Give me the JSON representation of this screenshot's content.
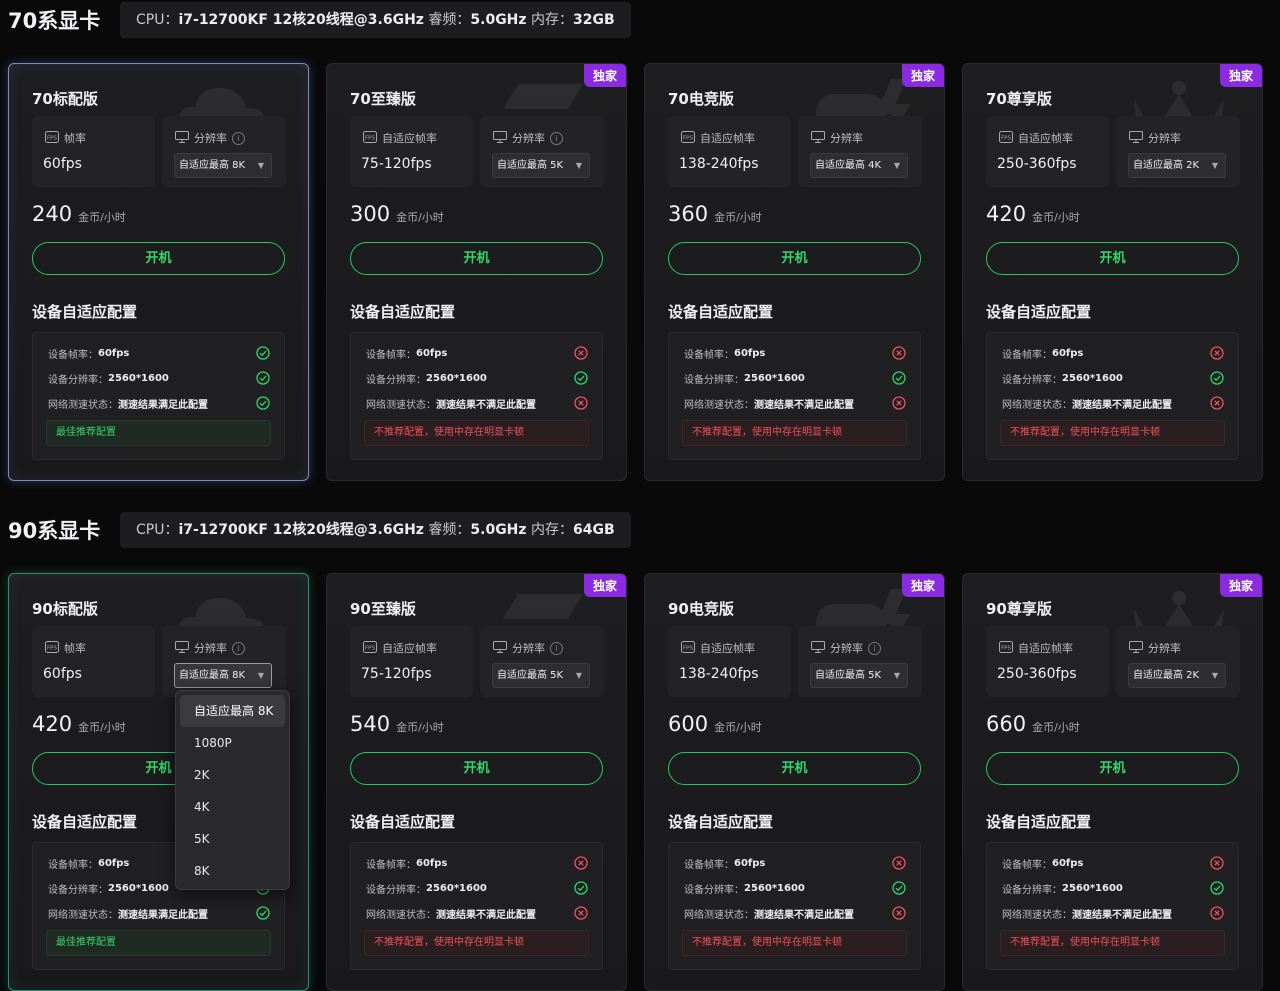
{
  "sections": [
    {
      "title": "70系显卡",
      "cpu": {
        "l1": "CPU：",
        "v1": "i7-12700KF 12核20线程@3.6GHz",
        "l2": " 睿频：",
        "v2": "5.0GHz",
        "l3": " 内存：",
        "v3": "32GB"
      },
      "cards": [
        {
          "name": "70标配版",
          "exclusive": "",
          "fps_label": "帧率",
          "fps": "60fps",
          "res_label": "分辨率",
          "res_value": "自适应最高 8K",
          "price": "240",
          "unit": "金币/小时",
          "button": "开机",
          "cfg_title": "设备自适应配置",
          "rows": [
            {
              "k": "设备帧率：",
              "v": "60fps",
              "ok": true
            },
            {
              "k": "设备分辨率：",
              "v": "2560*1600",
              "ok": true
            },
            {
              "k": "网络测速状态：",
              "v": "测速结果满足此配置",
              "ok": true
            }
          ],
          "verdict": "最佳推荐配置",
          "verdict_ok": true
        },
        {
          "name": "70至臻版",
          "exclusive": "独家",
          "fps_label": "自适应帧率",
          "fps": "75-120fps",
          "res_label": "分辨率",
          "res_value": "自适应最高 5K",
          "price": "300",
          "unit": "金币/小时",
          "button": "开机",
          "cfg_title": "设备自适应配置",
          "rows": [
            {
              "k": "设备帧率：",
              "v": "60fps",
              "ok": false
            },
            {
              "k": "设备分辨率：",
              "v": "2560*1600",
              "ok": true
            },
            {
              "k": "网络测速状态：",
              "v": "测速结果不满足此配置",
              "ok": false
            }
          ],
          "verdict": "不推荐配置，使用中存在明显卡顿",
          "verdict_ok": false
        },
        {
          "name": "70电竞版",
          "exclusive": "独家",
          "fps_label": "自适应帧率",
          "fps": "138-240fps",
          "res_label": "分辨率",
          "res_value": "自适应最高 4K",
          "price": "360",
          "unit": "金币/小时",
          "button": "开机",
          "cfg_title": "设备自适应配置",
          "rows": [
            {
              "k": "设备帧率：",
              "v": "60fps",
              "ok": false
            },
            {
              "k": "设备分辨率：",
              "v": "2560*1600",
              "ok": true
            },
            {
              "k": "网络测速状态：",
              "v": "测速结果不满足此配置",
              "ok": false
            }
          ],
          "verdict": "不推荐配置，使用中存在明显卡顿",
          "verdict_ok": false
        },
        {
          "name": "70尊享版",
          "exclusive": "独家",
          "fps_label": "自适应帧率",
          "fps": "250-360fps",
          "res_label": "分辨率",
          "res_value": "自适应最高 2K",
          "price": "420",
          "unit": "金币/小时",
          "button": "开机",
          "cfg_title": "设备自适应配置",
          "rows": [
            {
              "k": "设备帧率：",
              "v": "60fps",
              "ok": false
            },
            {
              "k": "设备分辨率：",
              "v": "2560*1600",
              "ok": true
            },
            {
              "k": "网络测速状态：",
              "v": "测速结果不满足此配置",
              "ok": false
            }
          ],
          "verdict": "不推荐配置，使用中存在明显卡顿",
          "verdict_ok": false
        }
      ]
    },
    {
      "title": "90系显卡",
      "cpu": {
        "l1": "CPU：",
        "v1": "i7-12700KF 12核20线程@3.6GHz",
        "l2": " 睿频：",
        "v2": "5.0GHz",
        "l3": " 内存：",
        "v3": "64GB"
      },
      "cards": [
        {
          "name": "90标配版",
          "exclusive": "",
          "fps_label": "帧率",
          "fps": "60fps",
          "res_label": "分辨率",
          "res_value": "自适应最高 8K",
          "price": "420",
          "unit": "金币/小时",
          "button": "开机",
          "cfg_title": "设备自适应配置",
          "rows": [
            {
              "k": "设备帧率：",
              "v": "60fps",
              "ok": true
            },
            {
              "k": "设备分辨率：",
              "v": "2560*1600",
              "ok": true
            },
            {
              "k": "网络测速状态：",
              "v": "测速结果满足此配置",
              "ok": true
            }
          ],
          "verdict": "最佳推荐配置",
          "verdict_ok": true
        },
        {
          "name": "90至臻版",
          "exclusive": "独家",
          "fps_label": "自适应帧率",
          "fps": "75-120fps",
          "res_label": "分辨率",
          "res_value": "自适应最高 5K",
          "price": "540",
          "unit": "金币/小时",
          "button": "开机",
          "cfg_title": "设备自适应配置",
          "rows": [
            {
              "k": "设备帧率：",
              "v": "60fps",
              "ok": false
            },
            {
              "k": "设备分辨率：",
              "v": "2560*1600",
              "ok": true
            },
            {
              "k": "网络测速状态：",
              "v": "测速结果不满足此配置",
              "ok": false
            }
          ],
          "verdict": "不推荐配置，使用中存在明显卡顿",
          "verdict_ok": false
        },
        {
          "name": "90电竞版",
          "exclusive": "独家",
          "fps_label": "自适应帧率",
          "fps": "138-240fps",
          "res_label": "分辨率",
          "res_value": "自适应最高 5K",
          "price": "600",
          "unit": "金币/小时",
          "button": "开机",
          "cfg_title": "设备自适应配置",
          "rows": [
            {
              "k": "设备帧率：",
              "v": "60fps",
              "ok": false
            },
            {
              "k": "设备分辨率：",
              "v": "2560*1600",
              "ok": true
            },
            {
              "k": "网络测速状态：",
              "v": "测速结果不满足此配置",
              "ok": false
            }
          ],
          "verdict": "不推荐配置，使用中存在明显卡顿",
          "verdict_ok": false
        },
        {
          "name": "90尊享版",
          "exclusive": "独家",
          "fps_label": "自适应帧率",
          "fps": "250-360fps",
          "res_label": "分辨率",
          "res_value": "自适应最高 2K",
          "price": "660",
          "unit": "金币/小时",
          "button": "开机",
          "cfg_title": "设备自适应配置",
          "rows": [
            {
              "k": "设备帧率：",
              "v": "60fps",
              "ok": false
            },
            {
              "k": "设备分辨率：",
              "v": "2560*1600",
              "ok": true
            },
            {
              "k": "网络测速状态：",
              "v": "测速结果不满足此配置",
              "ok": false
            }
          ],
          "verdict": "不推荐配置，使用中存在明显卡顿",
          "verdict_ok": false
        }
      ]
    }
  ],
  "dropdown": {
    "options": [
      "自适应最高 8K",
      "1080P",
      "2K",
      "4K",
      "5K",
      "8K"
    ]
  },
  "colors": {
    "accent_green": "#2fd86a",
    "exclusive_purple": "#8a2be2",
    "error_red": "#f0505c"
  }
}
